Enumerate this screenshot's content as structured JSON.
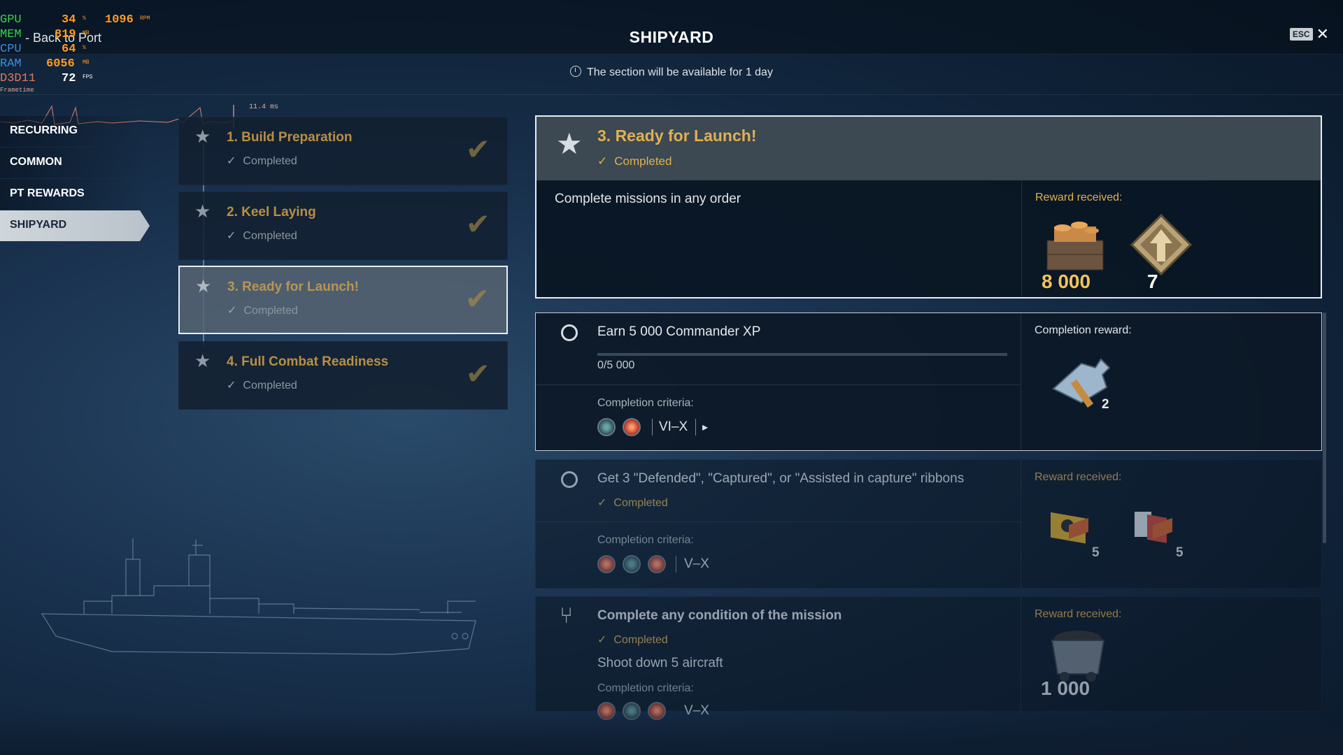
{
  "window": {
    "title": "SHIPYARD",
    "esc_label": "ESC",
    "close_glyph": "✕"
  },
  "availability": "The section will be available for 1 day",
  "hud": {
    "rows": [
      {
        "key": "GPU",
        "value": "34",
        "unit": "%",
        "extra": "1096",
        "extra_unit": "RPM",
        "key_color": "#3cd24a"
      },
      {
        "key": "MEM",
        "value": "819",
        "unit": "MB",
        "key_color": "#3cd24a"
      },
      {
        "key": "CPU",
        "value": "64",
        "unit": "%",
        "key_color": "#3a8fe0"
      },
      {
        "key": "RAM",
        "value": "6056",
        "unit": "MB",
        "key_color": "#3a8fe0"
      },
      {
        "key": "D3D11",
        "value": "72",
        "unit": "FPS",
        "key_color": "#e07a5a"
      }
    ],
    "frametime_label": "Frametime",
    "frametime_value": "11.4 ms"
  },
  "back_label": "- Back to Port",
  "categories": [
    {
      "label": "RECURRING",
      "active": false
    },
    {
      "label": "COMMON",
      "active": false
    },
    {
      "label": "PT REWARDS",
      "active": false
    },
    {
      "label": "SHIPYARD",
      "active": true
    }
  ],
  "steps": [
    {
      "title": "1. Build Preparation",
      "status": "Completed"
    },
    {
      "title": "2. Keel Laying",
      "status": "Completed"
    },
    {
      "title": "3. Ready for Launch!",
      "status": "Completed"
    },
    {
      "title": "4. Full Combat Readiness",
      "status": "Completed"
    }
  ],
  "detail": {
    "title": "3. Ready for Launch!",
    "status": "Completed",
    "description": "Complete missions in any order",
    "reward_label": "Reward received:",
    "rewards": [
      {
        "icon": "credits-crate-icon",
        "amount": "8 000"
      },
      {
        "icon": "rank-badge-icon",
        "amount": "7"
      }
    ]
  },
  "missions": [
    {
      "title": "Earn 5 000 Commander XP",
      "progress_text": "0/5 000",
      "progress": 0,
      "criteria_label": "Completion criteria:",
      "tiers": "VI–X",
      "reward_label": "Completion reward:",
      "rewards": [
        {
          "icon": "hammer-wrench-icon",
          "count": "2"
        }
      ]
    },
    {
      "title": "Get 3 \"Defended\", \"Captured\", or \"Assisted in capture\" ribbons",
      "status": "Completed",
      "criteria_label": "Completion criteria:",
      "tiers": "V–X",
      "reward_label": "Reward received:",
      "rewards": [
        {
          "icon": "signal-flag-yellow-icon",
          "count": "5"
        },
        {
          "icon": "signal-flag-red-icon",
          "count": "5"
        }
      ]
    },
    {
      "title": "Complete any condition of the mission",
      "status": "Completed",
      "subtitle": "Shoot down 5 aircraft",
      "criteria_label": "Completion criteria:",
      "tiers": "V–X",
      "reward_label": "Reward received:",
      "rewards": [
        {
          "icon": "coal-cart-icon",
          "amount": "1 000"
        }
      ]
    }
  ]
}
